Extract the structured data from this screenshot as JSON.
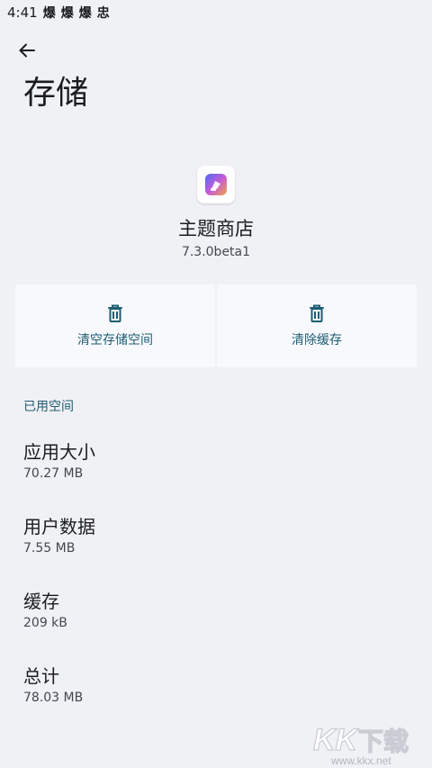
{
  "status_bar": {
    "time": "4:41",
    "icons": [
      "爆",
      "爆",
      "爆",
      "忠"
    ]
  },
  "header": {
    "back_icon": "arrow-back-icon",
    "title": "存储"
  },
  "app": {
    "icon": "theme-store-app-icon",
    "name": "主题商店",
    "version": "7.3.0beta1"
  },
  "actions": {
    "clear_storage": {
      "label": "清空存储空间",
      "icon": "trash-icon"
    },
    "clear_cache": {
      "label": "清除缓存",
      "icon": "trash-icon"
    }
  },
  "used_space": {
    "header": "已用空间",
    "items": [
      {
        "label": "应用大小",
        "value": "70.27 MB"
      },
      {
        "label": "用户数据",
        "value": "7.55 MB"
      },
      {
        "label": "缓存",
        "value": "209 kB"
      },
      {
        "label": "总计",
        "value": "78.03 MB"
      }
    ]
  },
  "watermark": {
    "brand": "KK下载",
    "url": "www.kkx.net"
  },
  "colors": {
    "background": "#f0f1f5",
    "accent": "#1d5c73",
    "card": "#f8f9fd"
  }
}
